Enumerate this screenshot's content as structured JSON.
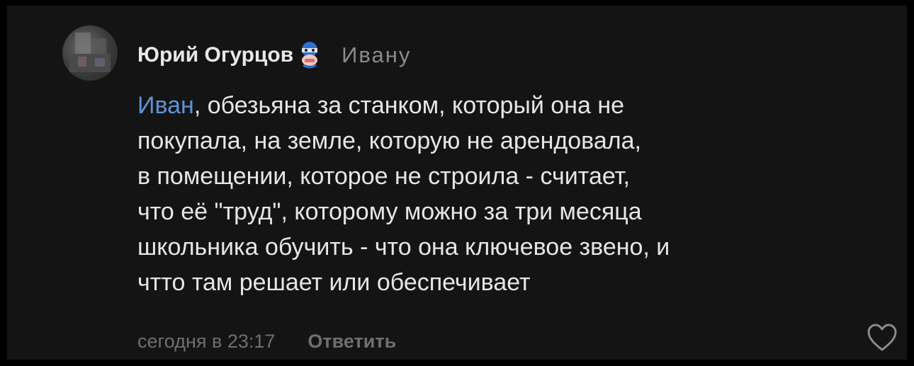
{
  "comment": {
    "author": "Юрий Огурцов",
    "reply_to": "Ивану",
    "mention": "Иван",
    "text_lines": [
      ", обезьяна за станком, который она не",
      "покупала, на земле, которую не арендовала,",
      "в помещении, которое не строила - считает,",
      "что её \"труд\", которому можно за три месяца",
      "школьника обучить - что она ключевое звено,  и",
      "чтто там решает или обеспечивает"
    ],
    "timestamp": "сегодня в 23:17",
    "reply_label": "Ответить",
    "badge_icon": "superhero-mask-icon",
    "like_icon": "heart-icon"
  },
  "colors": {
    "background": "#141414",
    "frame": "#000000",
    "author": "#e8e8e8",
    "text": "#e6e6e6",
    "mention": "#5e93d6",
    "muted": "#6f6f6f"
  }
}
